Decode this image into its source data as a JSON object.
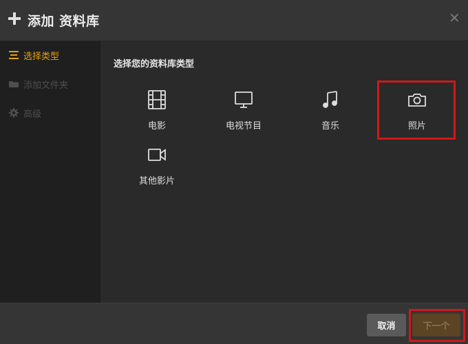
{
  "dialog": {
    "title": "添加 资料库",
    "close_icon": "close-icon",
    "plus_icon": "plus-icon"
  },
  "sidebar": {
    "items": [
      {
        "label": "选择类型",
        "icon": "list-icon",
        "state": "active"
      },
      {
        "label": "添加文件夹",
        "icon": "folder-icon",
        "state": "disabled"
      },
      {
        "label": "高级",
        "icon": "gear-icon",
        "state": "disabled"
      }
    ]
  },
  "main": {
    "prompt": "选择您的资料库类型",
    "types": [
      {
        "label": "电影",
        "icon": "film-icon"
      },
      {
        "label": "电视节目",
        "icon": "tv-icon"
      },
      {
        "label": "音乐",
        "icon": "music-note-icon"
      },
      {
        "label": "照片",
        "icon": "camera-icon",
        "highlighted": true
      },
      {
        "label": "其他影片",
        "icon": "video-camera-icon"
      }
    ]
  },
  "footer": {
    "cancel_label": "取消",
    "next_label": "下一个"
  },
  "colors": {
    "accent": "#e5a00d",
    "highlight_box": "#d01818",
    "next_button_bg": "#5b4424"
  }
}
